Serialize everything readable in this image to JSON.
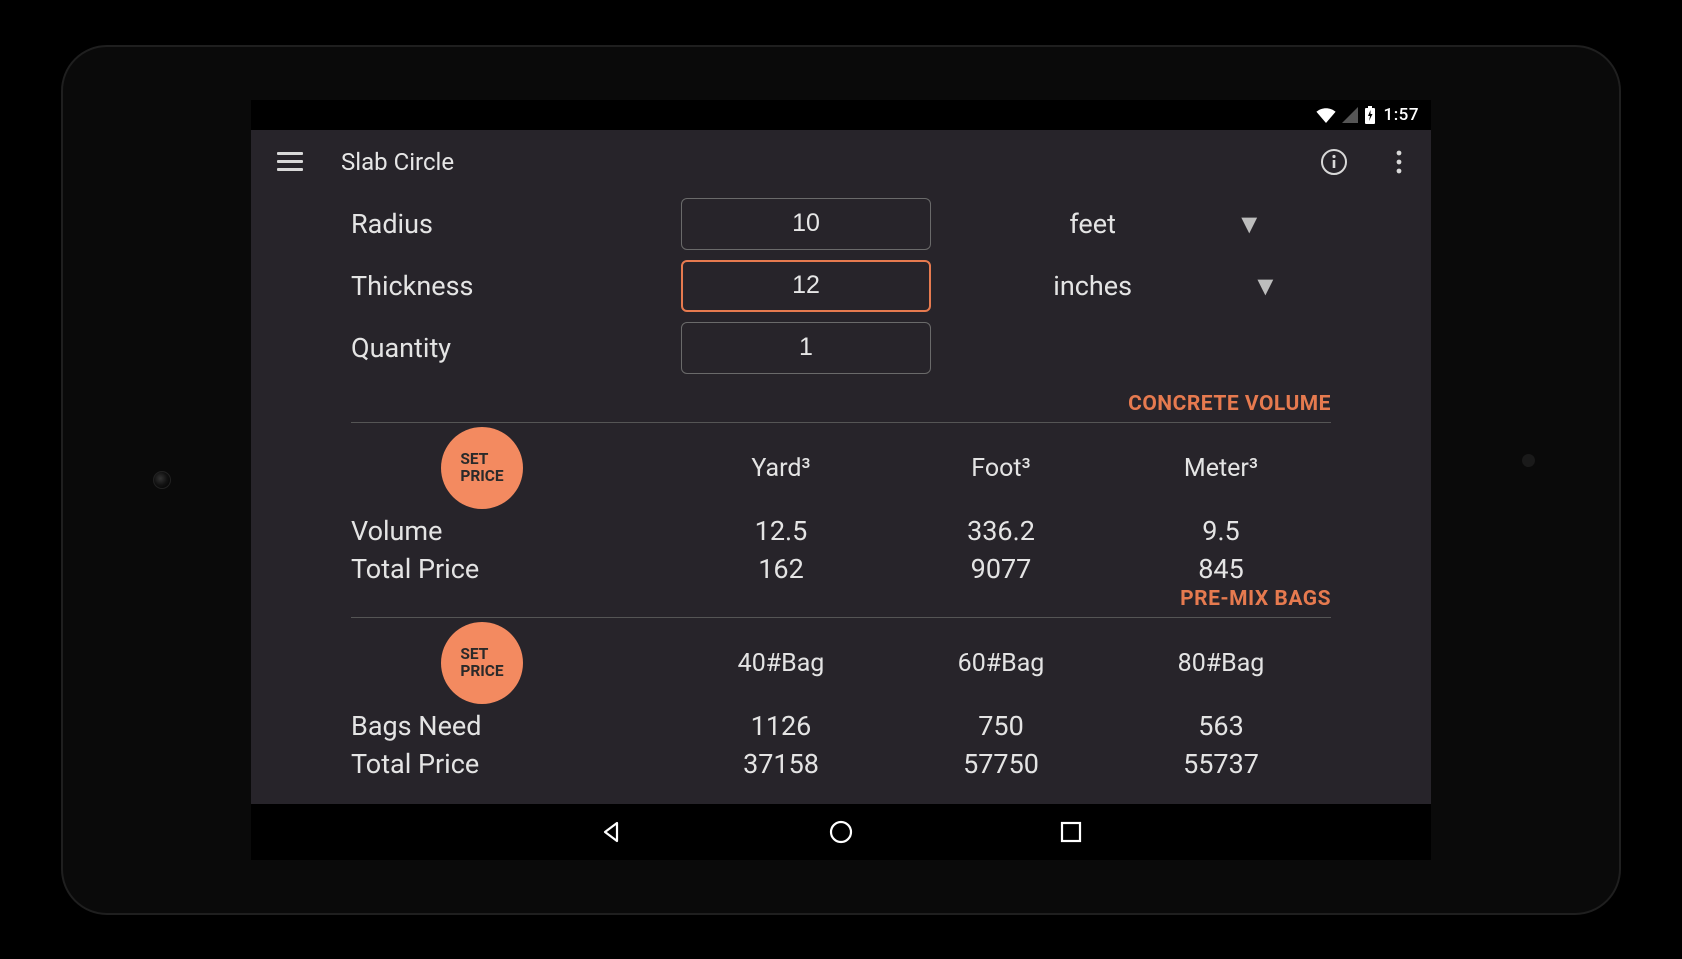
{
  "status": {
    "time": "1:57"
  },
  "appbar": {
    "title": "Slab Circle"
  },
  "form": {
    "radius": {
      "label": "Radius",
      "value": "10",
      "unit": "feet"
    },
    "thickness": {
      "label": "Thickness",
      "value": "12",
      "unit": "inches"
    },
    "quantity": {
      "label": "Quantity",
      "value": "1"
    }
  },
  "volume": {
    "section": "CONCRETE VOLUME",
    "set_price": "SET\nPRICE",
    "headers": {
      "c1": "Yard³",
      "c2": "Foot³",
      "c3": "Meter³"
    },
    "rows": {
      "volume": {
        "label": "Volume",
        "c1": "12.5",
        "c2": "336.2",
        "c3": "9.5"
      },
      "total": {
        "label": "Total Price",
        "c1": "162",
        "c2": "9077",
        "c3": "845"
      }
    }
  },
  "bags": {
    "section": "PRE-MIX BAGS",
    "set_price": "SET\nPRICE",
    "headers": {
      "c1": "40#Bag",
      "c2": "60#Bag",
      "c3": "80#Bag"
    },
    "rows": {
      "need": {
        "label": "Bags Need",
        "c1": "1126",
        "c2": "750",
        "c3": "563"
      },
      "total": {
        "label": "Total Price",
        "c1": "37158",
        "c2": "57750",
        "c3": "55737"
      }
    }
  }
}
